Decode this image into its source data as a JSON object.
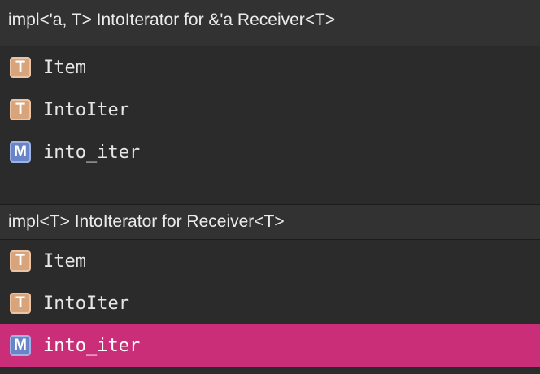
{
  "groups": [
    {
      "header": "impl<'a, T> IntoIterator for &'a Receiver<T>",
      "items": [
        {
          "kind_letter": "T",
          "kind": "type",
          "label": "Item"
        },
        {
          "kind_letter": "T",
          "kind": "type",
          "label": "IntoIter"
        },
        {
          "kind_letter": "M",
          "kind": "method",
          "label": "into_iter"
        }
      ]
    },
    {
      "header": "impl<T> IntoIterator for Receiver<T>",
      "items": [
        {
          "kind_letter": "T",
          "kind": "type",
          "label": "Item"
        },
        {
          "kind_letter": "T",
          "kind": "type",
          "label": "IntoIter"
        },
        {
          "kind_letter": "M",
          "kind": "method",
          "label": "into_iter",
          "selected": true
        }
      ]
    }
  ],
  "colors": {
    "background": "#2b2b2b",
    "header_background": "#323232",
    "selection": "#ca2e79",
    "type_badge": "#d8a47c",
    "method_badge": "#6a84c8"
  },
  "icons": {
    "type": "type-T-badge-icon",
    "method": "method-M-badge-icon"
  }
}
